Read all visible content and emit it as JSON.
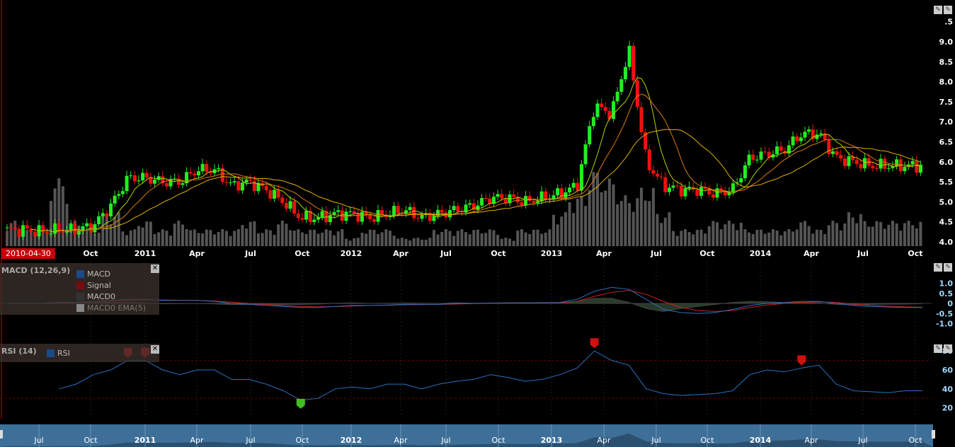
{
  "main": {
    "start_date": "2010-04-30",
    "y_ticks": [
      "4.0",
      "4.5",
      "5.0",
      "5.5",
      "6.0",
      "6.5",
      "7.0",
      "7.5",
      "8.0",
      "8.5",
      "9.0",
      ".5"
    ],
    "x_ticks": [
      {
        "label": "Oct",
        "bold": false
      },
      {
        "label": "2011",
        "bold": true
      },
      {
        "label": "Apr",
        "bold": false
      },
      {
        "label": "Jul",
        "bold": false
      },
      {
        "label": "Oct",
        "bold": false
      },
      {
        "label": "2012",
        "bold": true
      },
      {
        "label": "Apr",
        "bold": false
      },
      {
        "label": "Jul",
        "bold": false
      },
      {
        "label": "Oct",
        "bold": false
      },
      {
        "label": "2013",
        "bold": true
      },
      {
        "label": "Apr",
        "bold": false
      },
      {
        "label": "Jul",
        "bold": false
      },
      {
        "label": "Oct",
        "bold": false
      },
      {
        "label": "2014",
        "bold": true
      },
      {
        "label": "Apr",
        "bold": false
      },
      {
        "label": "Jul",
        "bold": false
      },
      {
        "label": "Oct",
        "bold": false
      }
    ]
  },
  "macd": {
    "title": "MACD (12,26,9)",
    "legend": [
      {
        "label": "MACD",
        "color": "#1a4a8a"
      },
      {
        "label": "Signal",
        "color": "#7a0a10"
      },
      {
        "label": "MACD0",
        "color": "#333333"
      },
      {
        "label": "MACD0 EMA(5)",
        "color": "#888888"
      }
    ],
    "y_ticks": [
      "1.0",
      "0.5",
      "0",
      "-0.5",
      "-1.0"
    ],
    "close_label": "✕"
  },
  "rsi": {
    "title": "RSI (14)",
    "legend": [
      {
        "label": "RSI",
        "color": "#1a4a8a"
      }
    ],
    "y_ticks": [
      "80",
      "60",
      "40",
      "20"
    ],
    "close_label": "✕"
  },
  "navigator": {
    "x_ticks": [
      "Jul",
      "Oct",
      "2011",
      "Apr",
      "Jul",
      "Oct",
      "2012",
      "Apr",
      "Jul",
      "Oct",
      "2013",
      "Apr",
      "Jul",
      "Oct",
      "2014",
      "Apr",
      "Jul",
      "Oct"
    ]
  },
  "colors": {
    "up": "#22ee22",
    "down": "#ee1111",
    "ma1": "#b8d000",
    "ma2": "#e07a10",
    "ma3": "#e0b000"
  },
  "chart_data": {
    "type": "candlestick",
    "period": "monthly approximation",
    "months_start": "2010-05",
    "close": [
      4.3,
      4.3,
      4.25,
      4.3,
      4.3,
      4.4,
      4.9,
      5.6,
      5.6,
      5.5,
      5.5,
      5.8,
      5.8,
      5.4,
      5.5,
      5.3,
      5.0,
      4.6,
      4.6,
      4.7,
      4.7,
      4.6,
      4.7,
      4.8,
      4.6,
      4.7,
      4.8,
      4.9,
      5.1,
      5.1,
      5.0,
      5.1,
      5.2,
      5.4,
      7.4,
      7.2,
      8.8,
      6.0,
      5.4,
      5.3,
      5.3,
      5.2,
      5.3,
      6.1,
      6.2,
      6.3,
      6.7,
      6.7,
      6.1,
      6.0,
      5.9,
      5.9,
      5.9,
      5.9
    ],
    "volume": [
      3,
      2,
      2,
      8,
      3,
      2,
      4,
      2,
      3,
      2,
      3,
      2,
      2,
      2,
      3,
      2,
      3,
      2,
      2,
      2,
      1,
      2,
      2,
      1,
      1,
      2,
      2,
      2,
      2,
      1,
      2,
      2,
      4,
      6,
      9,
      8,
      6,
      7,
      4,
      2,
      2,
      3,
      3,
      2,
      2,
      2,
      3,
      2,
      3,
      4,
      3,
      3,
      3,
      3
    ],
    "macd": [
      0,
      0,
      0,
      0.05,
      0.05,
      0.1,
      0.15,
      0.2,
      0.2,
      0.15,
      0.15,
      0.15,
      0.1,
      0,
      -0.05,
      -0.1,
      -0.15,
      -0.2,
      -0.2,
      -0.15,
      -0.1,
      -0.1,
      -0.08,
      -0.05,
      -0.05,
      -0.05,
      0,
      0,
      0.02,
      0.03,
      0.03,
      0.04,
      0.05,
      0.2,
      0.6,
      0.8,
      0.7,
      0.2,
      -0.3,
      -0.45,
      -0.5,
      -0.45,
      -0.3,
      -0.1,
      0,
      0.05,
      0.1,
      0.1,
      0,
      -0.1,
      -0.15,
      -0.18,
      -0.2,
      -0.2
    ],
    "signal": [
      0,
      0,
      0,
      0.02,
      0.03,
      0.05,
      0.1,
      0.15,
      0.18,
      0.17,
      0.16,
      0.15,
      0.12,
      0.06,
      0,
      -0.05,
      -0.1,
      -0.15,
      -0.17,
      -0.16,
      -0.13,
      -0.1,
      -0.09,
      -0.07,
      -0.06,
      -0.05,
      -0.03,
      -0.01,
      0.01,
      0.02,
      0.03,
      0.03,
      0.04,
      0.1,
      0.35,
      0.55,
      0.65,
      0.45,
      0.1,
      -0.2,
      -0.35,
      -0.4,
      -0.35,
      -0.2,
      -0.08,
      0,
      0.05,
      0.08,
      0.05,
      -0.03,
      -0.1,
      -0.14,
      -0.17,
      -0.19
    ],
    "rsi": [
      null,
      null,
      null,
      40,
      45,
      55,
      60,
      70,
      70,
      60,
      55,
      60,
      60,
      50,
      50,
      45,
      38,
      28,
      30,
      40,
      42,
      40,
      45,
      45,
      40,
      45,
      48,
      50,
      55,
      52,
      48,
      50,
      55,
      62,
      80,
      70,
      65,
      40,
      35,
      33,
      34,
      35,
      38,
      55,
      60,
      58,
      62,
      65,
      45,
      38,
      37,
      36,
      38,
      38
    ],
    "y_range": [
      4.0,
      9.5
    ],
    "macd_range": [
      -1.2,
      1.2
    ],
    "rsi_range": [
      10,
      90
    ]
  }
}
